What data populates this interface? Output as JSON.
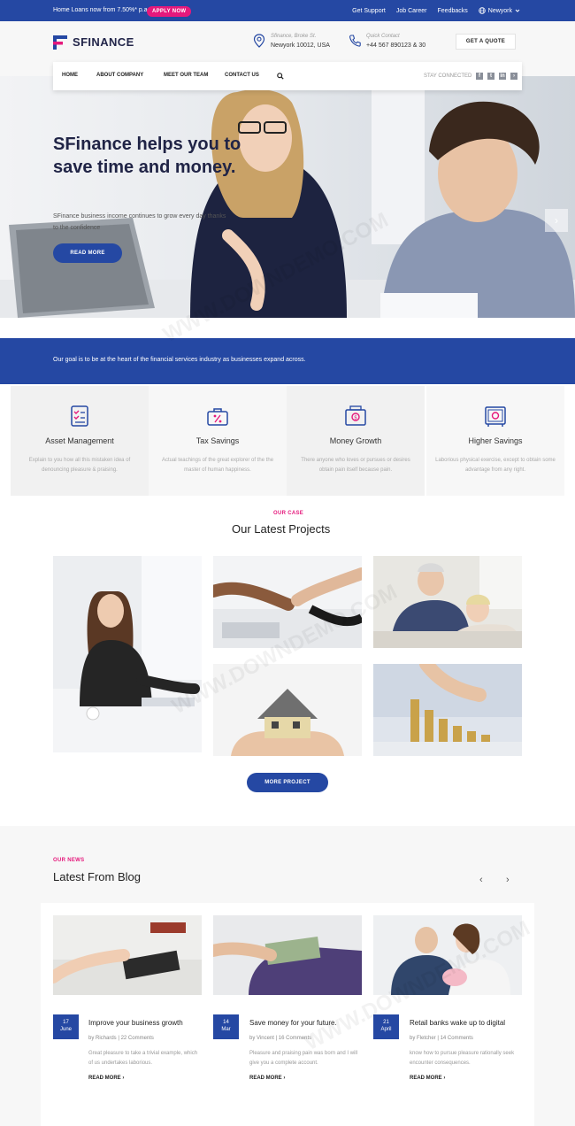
{
  "topbar": {
    "promo": "Home Loans now from 7.50%* p.a.",
    "apply": "APPLY NOW",
    "links": [
      "Get Support",
      "Job Career",
      "Feedbacks"
    ],
    "location": "Newyork"
  },
  "header": {
    "logo": "SFINANCE",
    "address_label": "Sfinance, Broke St.",
    "address": "Newyork 10012, USA",
    "contact_label": "Quick Contact",
    "phone": "+44 567 890123 & 30",
    "quote_button": "GET A QUOTE"
  },
  "nav": {
    "items": [
      "HOME",
      "ABOUT COMPANY",
      "MEET OUR TEAM",
      "CONTACT US"
    ],
    "stay_connected": "STAY CONNECTED"
  },
  "hero": {
    "title": "SFinance helps you to save time and money.",
    "subtitle": "SFinance business income continues to grow every day thanks to the confidence",
    "button": "READ MORE"
  },
  "goal": "Our goal is to be at the heart of the financial services industry as businesses expand across.",
  "services": [
    {
      "title": "Asset Management",
      "desc": "Explain to you how all this mistaken idea of denouncing pleasure & praising.",
      "icon": "checklist-icon"
    },
    {
      "title": "Tax Savings",
      "desc": "Actual teachings of the great explorer of the the master of human happiness.",
      "icon": "briefcase-percent-icon"
    },
    {
      "title": "Money Growth",
      "desc": "There anyone who loves or pursues or desires obtain pain itself because pain.",
      "icon": "cash-register-icon"
    },
    {
      "title": "Higher Savings",
      "desc": "Laborious physical exercise, except to obtain some advantage from any right.",
      "icon": "safe-icon"
    }
  ],
  "projects": {
    "kicker": "OUR CASE",
    "title": "Our Latest Projects",
    "button": "MORE PROJECT"
  },
  "blog": {
    "kicker": "OUR NEWS",
    "title": "Latest From Blog",
    "posts": [
      {
        "day": "17",
        "month": "June",
        "title": "Improve your business growth",
        "meta": "by Richards | 22 Comments",
        "excerpt": "Great pleasure to take a trivial example, which of us undertakes laborious.",
        "more": "READ MORE ›"
      },
      {
        "day": "14",
        "month": "Mar",
        "title": "Save money for your future.",
        "meta": "by Vincent | 16 Comments",
        "excerpt": "Pleasure and praising pain was born and I will give you a complete account.",
        "more": "READ MORE ›"
      },
      {
        "day": "21",
        "month": "April",
        "title": "Retail banks wake up to digital",
        "meta": "by Fletcher | 14 Comments",
        "excerpt": "know how to pursue pleasure rationally seek encounter consequences.",
        "more": "READ MORE ›"
      }
    ]
  },
  "watermark": "WWW.DOWNDEMO.COM",
  "colors": {
    "primary": "#2548a3",
    "accent": "#e5197c",
    "dark": "#202446"
  }
}
